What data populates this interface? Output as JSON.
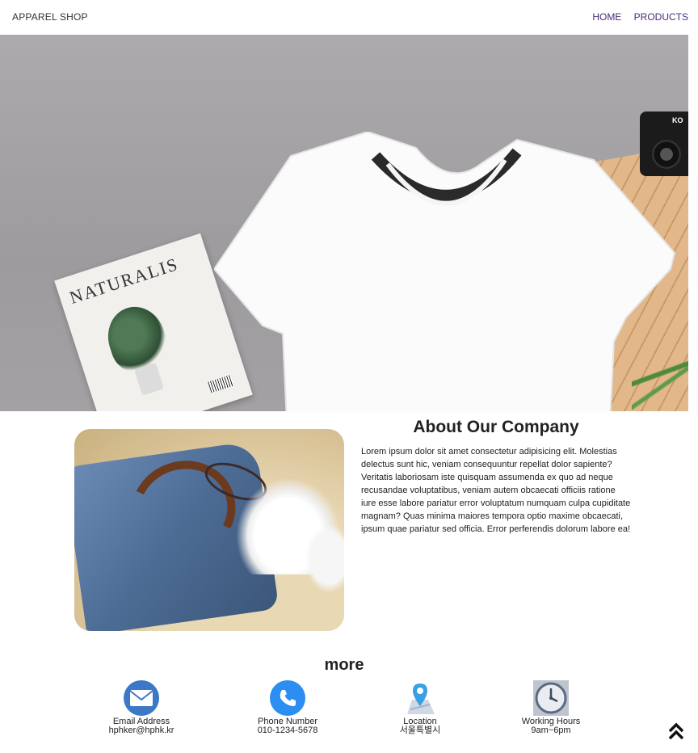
{
  "header": {
    "brand": "APPAREL SHOP",
    "nav": [
      {
        "label": "HOME"
      },
      {
        "label": "PRODUCTS"
      }
    ]
  },
  "hero": {
    "magazine_title": "NATURALIS",
    "camera_label": "KO"
  },
  "about": {
    "title": "About Our Company",
    "body": "Lorem ipsum dolor sit amet consectetur adipisicing elit. Molestias delectus sunt hic, veniam consequuntur repellat dolor sapiente? Veritatis laboriosam iste quisquam assumenda ex quo ad neque recusandae voluptatibus, veniam autem obcaecati officiis ratione iure esse labore pariatur error voluptatum numquam culpa cupiditate magnam? Quas minima maiores tempora optio maxime obcaecati, ipsum quae pariatur sed officia. Error perferendis dolorum labore ea!"
  },
  "more": {
    "title": "more",
    "items": [
      {
        "icon": "envelope-icon",
        "label": "Email Address",
        "value": "hphker@hphk.kr"
      },
      {
        "icon": "phone-icon",
        "label": "Phone Number",
        "value": "010-1234-5678"
      },
      {
        "icon": "map-pin-icon",
        "label": "Location",
        "value": "서울특별시"
      },
      {
        "icon": "clock-icon",
        "label": "Working Hours",
        "value": "9am~6pm"
      }
    ]
  },
  "colors": {
    "nav_link": "#4a2a7a",
    "email_icon": "#3b78c6",
    "phone_icon": "#2c8ef0"
  }
}
